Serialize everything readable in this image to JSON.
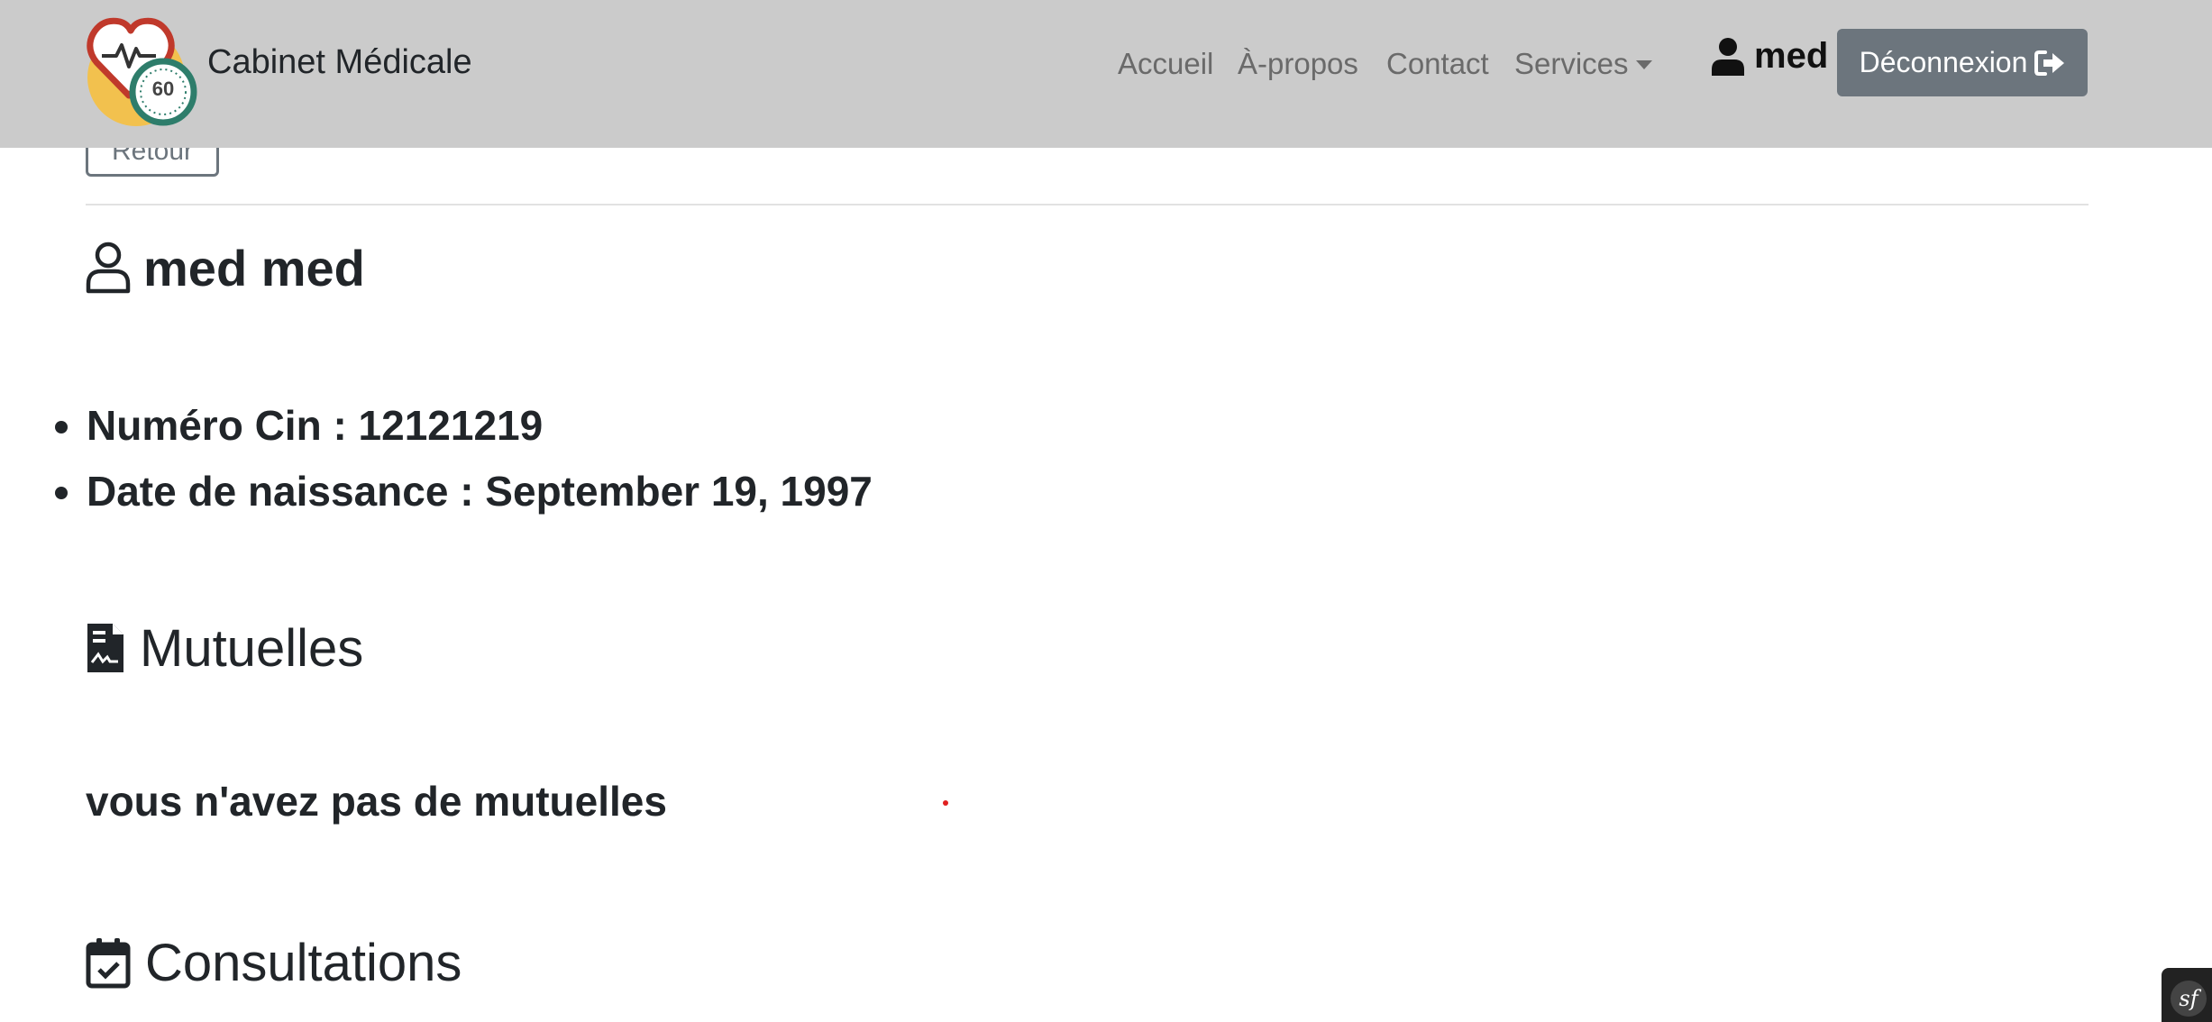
{
  "navbar": {
    "brand": "Cabinet Médicale",
    "logo_badge": "60",
    "links": {
      "accueil": "Accueil",
      "apropos": "À-propos",
      "contact": "Contact",
      "services": "Services"
    },
    "user_name": "med",
    "logout_label": "Déconnexion"
  },
  "main": {
    "back_label": "Retour",
    "patient_name": "med med",
    "info": {
      "cin": "Numéro Cin : 12121219",
      "birthdate": "Date de naissance : September 19, 1997"
    },
    "mutuelles_title": "Mutuelles",
    "mutuelles_empty": "vous n'avez pas de mutuelles",
    "consultations_title": "Consultations"
  },
  "icons": {
    "logo": "heart-clock-logo",
    "user": "user-icon",
    "user_outline": "user-outline-icon",
    "document": "file-medical-icon",
    "calendar": "calendar-check-icon",
    "logout": "sign-out-icon",
    "dropdown": "caret-down-icon",
    "symfony": "symfony-icon"
  },
  "colors": {
    "navbar_bg": "#cbcbcb",
    "button_secondary": "#6c757d",
    "text": "#212529",
    "logo_yellow": "#f2c14e",
    "logo_red": "#c0392b",
    "logo_green": "#2e7d6b"
  }
}
